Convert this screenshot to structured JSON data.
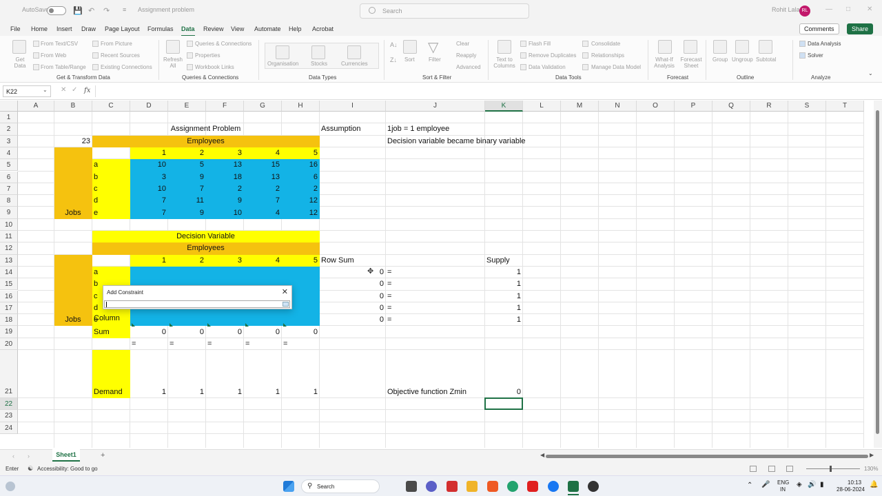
{
  "titlebar": {
    "autosave_label": "AutoSave",
    "doc_title": "Assignment problem",
    "search_placeholder": "Search",
    "user_name": "Rohit Lala",
    "user_initials": "RL"
  },
  "menu": {
    "items": [
      "File",
      "Home",
      "Insert",
      "Draw",
      "Page Layout",
      "Formulas",
      "Data",
      "Review",
      "View",
      "Automate",
      "Help",
      "Acrobat"
    ],
    "active": "Data",
    "comments_label": "Comments",
    "share_label": "Share"
  },
  "ribbon": {
    "get_data": "Get Data",
    "from_text_csv": "From Text/CSV",
    "from_web": "From Web",
    "from_table_range": "From Table/Range",
    "from_picture": "From Picture",
    "recent_sources": "Recent Sources",
    "existing_connections": "Existing Connections",
    "group_get_transform": "Get & Transform Data",
    "refresh_all": "Refresh All",
    "queries_connections": "Queries & Connections",
    "properties": "Properties",
    "workbook_links": "Workbook Links",
    "group_queries": "Queries & Connections",
    "organisation": "Organisation",
    "stocks": "Stocks",
    "currencies": "Currencies",
    "group_data_types": "Data Types",
    "sort": "Sort",
    "filter": "Filter",
    "clear": "Clear",
    "reapply": "Reapply",
    "advanced": "Advanced",
    "group_sort_filter": "Sort & Filter",
    "text_to_columns": "Text to Columns",
    "flash_fill": "Flash Fill",
    "remove_duplicates": "Remove Duplicates",
    "data_validation": "Data Validation",
    "consolidate": "Consolidate",
    "relationships": "Relationships",
    "manage_data_model": "Manage Data Model",
    "group_data_tools": "Data Tools",
    "what_if": "What-If Analysis",
    "forecast_sheet": "Forecast Sheet",
    "group_forecast": "Forecast",
    "group": "Group",
    "ungroup": "Ungroup",
    "subtotal": "Subtotal",
    "group_outline": "Outline",
    "data_analysis": "Data Analysis",
    "solver": "Solver",
    "group_analyze": "Analyze"
  },
  "formula_bar": {
    "name_box": "K22",
    "fx": "fx",
    "content": ""
  },
  "columns": [
    "A",
    "B",
    "C",
    "D",
    "E",
    "F",
    "G",
    "H",
    "I",
    "J",
    "K",
    "L",
    "M",
    "N",
    "O",
    "P",
    "Q",
    "R",
    "S",
    "T"
  ],
  "rows": [
    "1",
    "2",
    "3",
    "4",
    "5",
    "6",
    "7",
    "8",
    "9",
    "10",
    "11",
    "12",
    "13",
    "14",
    "15",
    "16",
    "17",
    "18",
    "19",
    "20",
    "21",
    "22",
    "23",
    "24"
  ],
  "sheet": {
    "title": "Assignment Problem",
    "assumption": "Assumption",
    "assumption_1": "1job = 1 employee",
    "assumption_2": "Decision variable became binary variable",
    "b3": "23",
    "employees": "Employees",
    "emp_ids": [
      "1",
      "2",
      "3",
      "4",
      "5"
    ],
    "jobs_label": "Jobs",
    "job_ids": [
      "a",
      "b",
      "c",
      "d",
      "e"
    ],
    "cost_matrix": [
      [
        "10",
        "5",
        "13",
        "15",
        "16"
      ],
      [
        "3",
        "9",
        "18",
        "13",
        "6"
      ],
      [
        "10",
        "7",
        "2",
        "2",
        "2"
      ],
      [
        "7",
        "11",
        "9",
        "7",
        "12"
      ],
      [
        "7",
        "9",
        "10",
        "4",
        "12"
      ]
    ],
    "decision_variable": "Decision Variable",
    "row_sum_label": "Row Sum",
    "supply_label": "Supply",
    "row_sums": [
      "0",
      "0",
      "0",
      "0",
      "0"
    ],
    "eq": "=",
    "supply": [
      "1",
      "1",
      "1",
      "1",
      "1"
    ],
    "column_label": "Column",
    "sum_label": "Sum",
    "col_sums": [
      "0",
      "0",
      "0",
      "0",
      "0"
    ],
    "demand_label": "Demand",
    "demand": [
      "1",
      "1",
      "1",
      "1",
      "1"
    ],
    "objective_label": "Objective function Zmin",
    "objective_value": "0"
  },
  "dialog": {
    "title": "Add Constraint",
    "close": "✕"
  },
  "tabs": {
    "sheet_name": "Sheet1",
    "add": "+"
  },
  "status": {
    "mode": "Enter",
    "accessibility": "Accessibility: Good to go",
    "zoom": "130%"
  },
  "taskbar": {
    "search": "Search",
    "lang_top": "ENG",
    "lang_bottom": "IN",
    "time": "10:13",
    "date": "28-06-2024"
  },
  "colors": {
    "yellow": "#ffff00",
    "orange": "#f5c20f",
    "blue": "#13b3e6",
    "excel_green": "#1e7145"
  }
}
